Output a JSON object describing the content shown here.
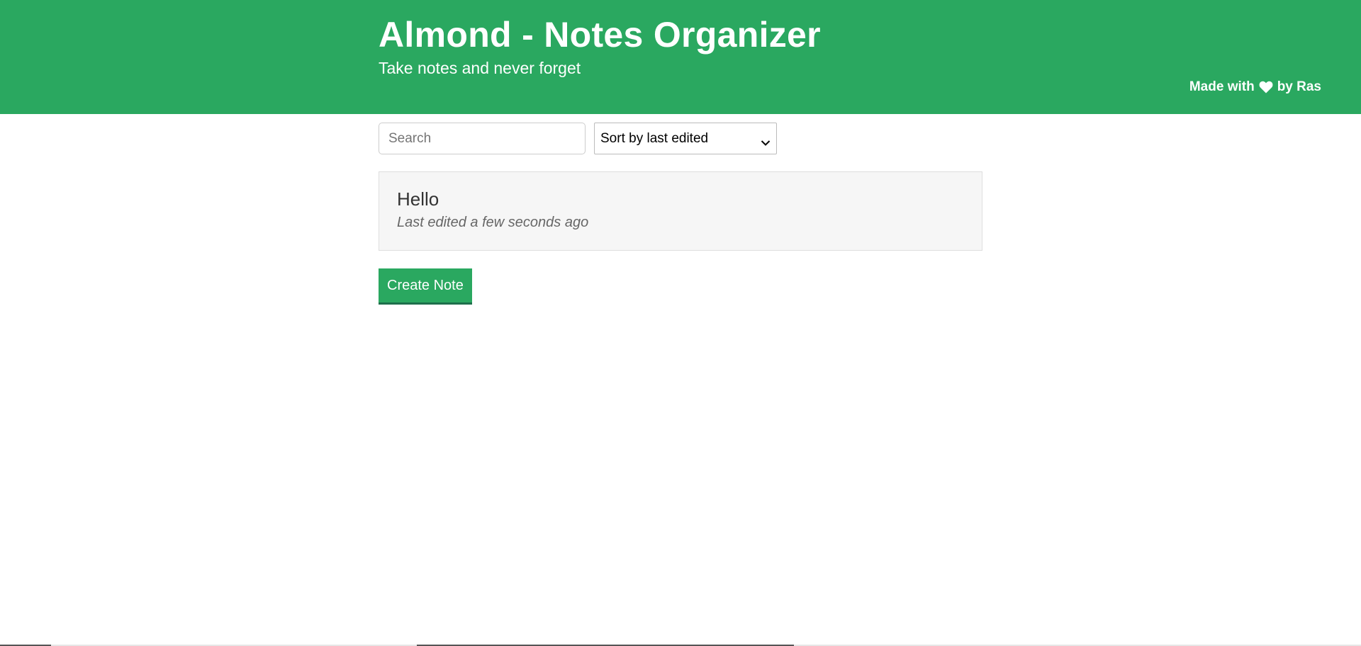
{
  "header": {
    "title": "Almond - Notes Organizer",
    "subtitle": "Take notes and never forget",
    "credit_prefix": "Made with",
    "credit_icon": "heart-icon",
    "credit_suffix": "by Ras"
  },
  "controls": {
    "search_placeholder": "Search",
    "search_value": "",
    "sort_selected": "Sort by last edited"
  },
  "notes": [
    {
      "title": "Hello",
      "meta": "Last edited a few seconds ago"
    }
  ],
  "actions": {
    "create_label": "Create Note"
  },
  "colors": {
    "brand": "#2aa860",
    "button_border": "#1f6f4c",
    "card_bg": "#f6f6f6"
  }
}
